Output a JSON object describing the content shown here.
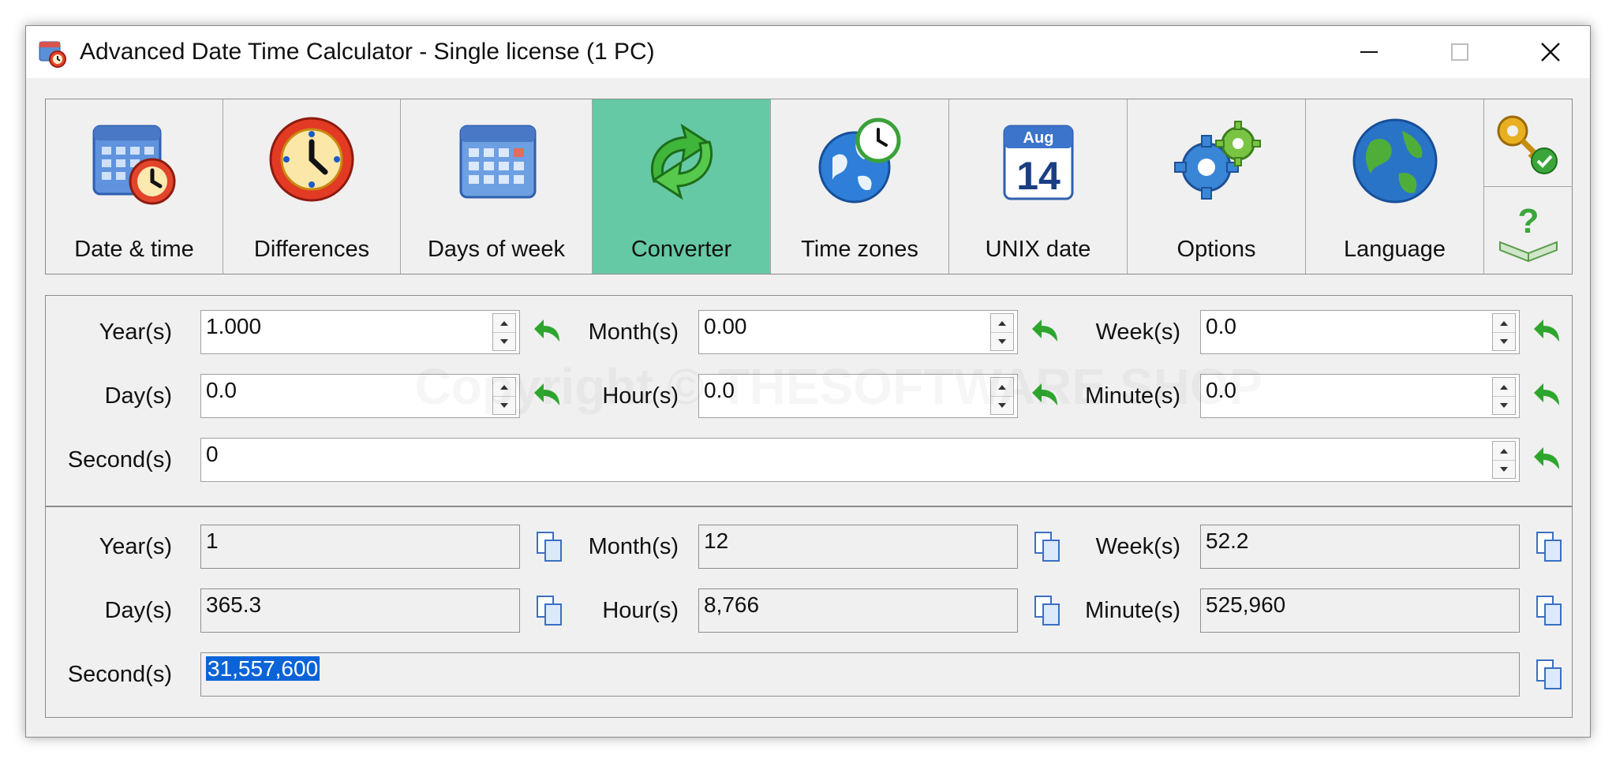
{
  "window": {
    "title": "Advanced Date Time Calculator - Single license (1 PC)",
    "icon": "app-calendar-clock-icon",
    "controls": [
      "minimize-icon",
      "maximize-icon",
      "close-icon"
    ]
  },
  "toolbar": {
    "active_tab": "Converter",
    "active_color": "#66c9a6",
    "tabs": [
      {
        "label": "Date & time",
        "icon": "calendar-clock-icon"
      },
      {
        "label": "Differences",
        "icon": "clock-icon"
      },
      {
        "label": "Days of week",
        "icon": "calendar-icon"
      },
      {
        "label": "Converter",
        "icon": "green-arrows-icon"
      },
      {
        "label": "Time zones",
        "icon": "globe-clock-icon"
      },
      {
        "label": "UNIX date",
        "icon": "calendar-date-icon",
        "icon_month": "Aug",
        "icon_day": "14"
      },
      {
        "label": "Options",
        "icon": "gears-icon"
      },
      {
        "label": "Language",
        "icon": "globe-icon"
      }
    ],
    "side_buttons": [
      "key-check-icon",
      "help-book-icon"
    ]
  },
  "input": {
    "rows": [
      [
        {
          "label": "Year(s)",
          "value": "1.000"
        },
        {
          "label": "Month(s)",
          "value": "0.00"
        },
        {
          "label": "Week(s)",
          "value": "0.0"
        }
      ],
      [
        {
          "label": "Day(s)",
          "value": "0.0"
        },
        {
          "label": "Hour(s)",
          "value": "0.0"
        },
        {
          "label": "Minute(s)",
          "value": "0.0"
        }
      ]
    ],
    "second": {
      "label": "Second(s)",
      "value": "0"
    }
  },
  "output": {
    "rows": [
      [
        {
          "label": "Year(s)",
          "value": "1"
        },
        {
          "label": "Month(s)",
          "value": "12"
        },
        {
          "label": "Week(s)",
          "value": "52.2"
        }
      ],
      [
        {
          "label": "Day(s)",
          "value": "365.3"
        },
        {
          "label": "Hour(s)",
          "value": "8,766"
        },
        {
          "label": "Minute(s)",
          "value": "525,960"
        }
      ]
    ],
    "second": {
      "label": "Second(s)",
      "value": "31,557,600"
    }
  },
  "watermark": "Copyright © THESOFTWARE SHOP"
}
